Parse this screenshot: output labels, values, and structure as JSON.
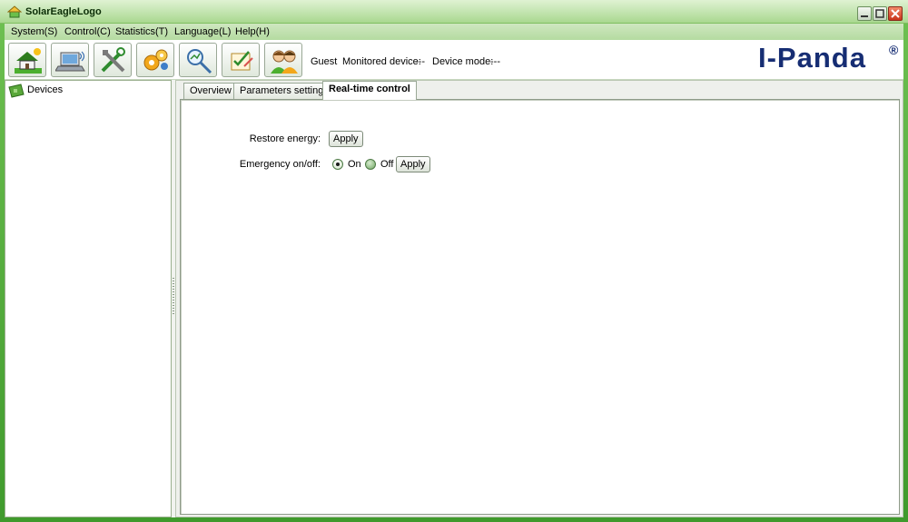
{
  "window": {
    "title": "SolarEagleLogo"
  },
  "menu": [
    {
      "label": "System(S)"
    },
    {
      "label": "Control(C)"
    },
    {
      "label": "Statistics(T)"
    },
    {
      "label": "Language(L)"
    },
    {
      "label": "Help(H)"
    }
  ],
  "toolbar": {
    "buttons": [
      {
        "icon": "house-solar-icon"
      },
      {
        "icon": "laptop-wireless-icon"
      },
      {
        "icon": "tools-icon"
      },
      {
        "icon": "gear-settings-icon"
      },
      {
        "icon": "magnifier-chart-icon"
      },
      {
        "icon": "checklist-edit-icon"
      },
      {
        "icon": "users-icon"
      }
    ],
    "user": "Guest",
    "monitored_device_label": "Monitored device:",
    "monitored_device_value": "---",
    "device_mode_label": "Device mode:",
    "device_mode_value": "---",
    "brand": "I-Panda",
    "brand_reg": "®"
  },
  "tree": {
    "root_label": "Devices"
  },
  "tabs": [
    {
      "label": "Overview"
    },
    {
      "label": "Parameters setting"
    },
    {
      "label": "Real-time control",
      "active": true
    }
  ],
  "realtime": {
    "restore_energy_label": "Restore energy:",
    "restore_apply": "Apply",
    "emergency_label": "Emergency on/off:",
    "on_label": "On",
    "off_label": "Off",
    "emergency_selected": "On",
    "emergency_apply": "Apply"
  },
  "colors": {
    "frame": "#3f9a2c",
    "brand": "#162d73"
  }
}
